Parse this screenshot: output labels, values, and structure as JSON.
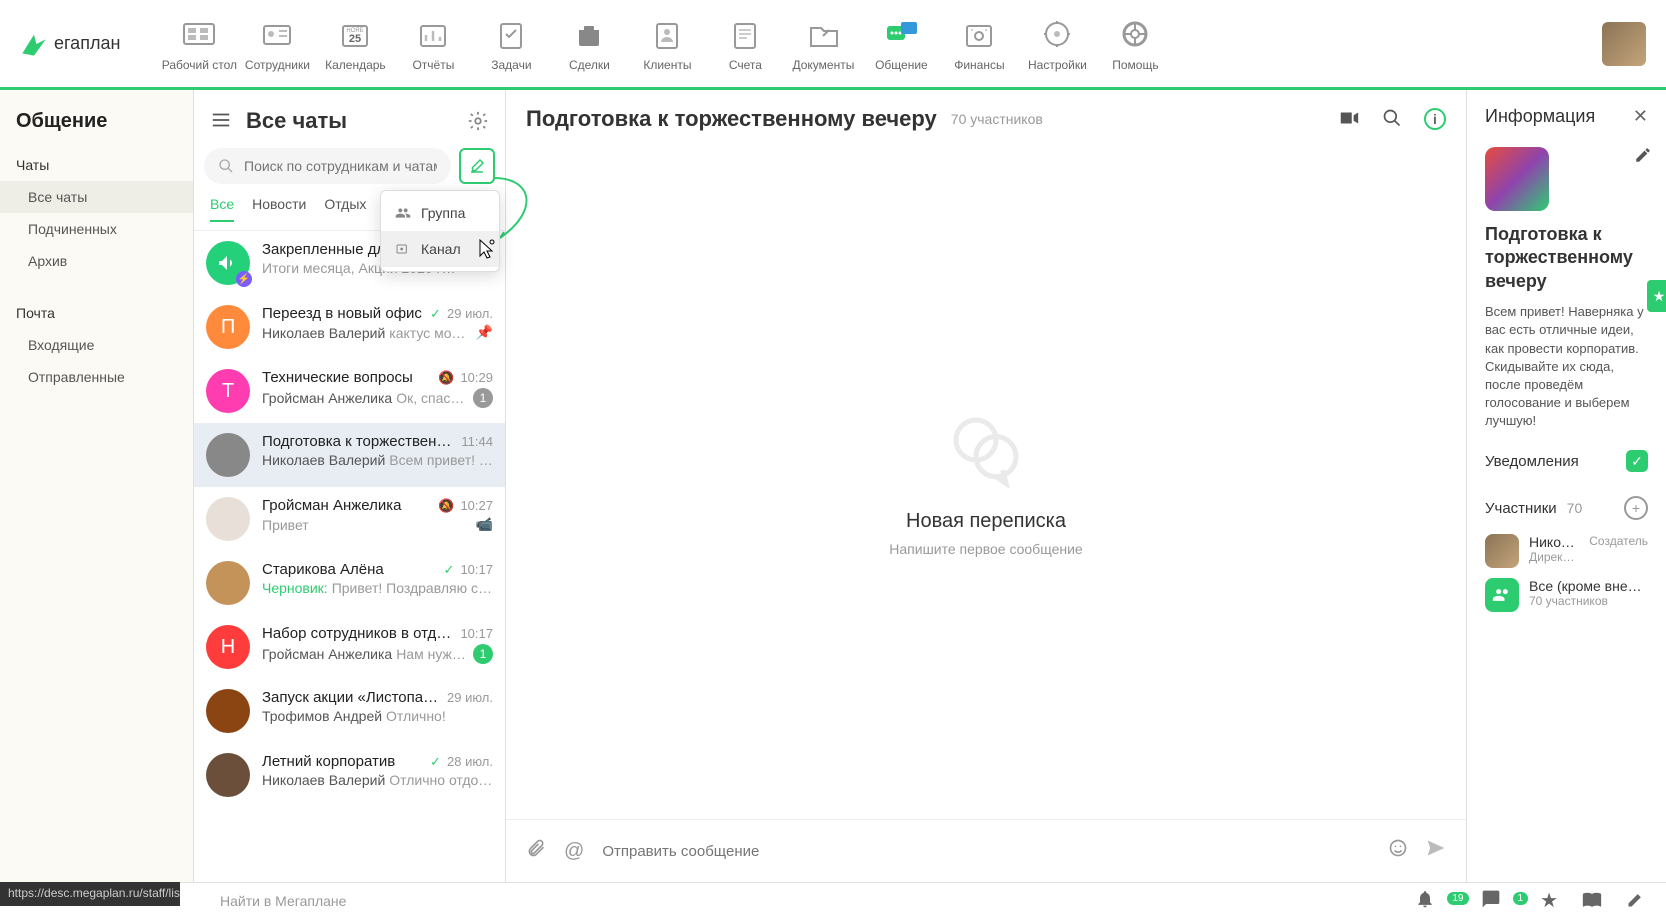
{
  "logo": "егаплан",
  "nav": [
    {
      "label": "Рабочий стол"
    },
    {
      "label": "Сотрудники"
    },
    {
      "label": "Календарь"
    },
    {
      "label": "Отчёты"
    },
    {
      "label": "Задачи"
    },
    {
      "label": "Сделки"
    },
    {
      "label": "Клиенты"
    },
    {
      "label": "Счета"
    },
    {
      "label": "Документы"
    },
    {
      "label": "Общение"
    },
    {
      "label": "Финансы"
    },
    {
      "label": "Настройки"
    },
    {
      "label": "Помощь"
    }
  ],
  "sidebar": {
    "title": "Общение",
    "chat_section": "Чаты",
    "items": [
      "Все чаты",
      "Подчиненных",
      "Архив"
    ],
    "mail_section": "Почта",
    "mail_items": [
      "Входящие",
      "Отправленные"
    ]
  },
  "chatcol": {
    "title": "Все чаты",
    "search_placeholder": "Поиск по сотрудникам и чатам",
    "tabs": [
      "Все",
      "Новости",
      "Отдых"
    ]
  },
  "dropdown": {
    "group": "Группа",
    "channel": "Канал"
  },
  "chats": [
    {
      "name": "Закрепленные для в…",
      "preview": "Итоги месяца, Акции 2020 г…",
      "avbg": "#25d07a",
      "megaphone": true
    },
    {
      "name": "Переезд в новый офис",
      "time": "29 июл.",
      "sender": "Николаев Валерий",
      "preview": "кактус можно …",
      "pin": true,
      "check": true,
      "avbg": "#ff8a3c",
      "letter": "П"
    },
    {
      "name": "Технические вопросы",
      "time": "10:29",
      "sender": "Гройсман Анжелика",
      "preview": "Ок, спасибо",
      "mute": true,
      "badge": "1",
      "avbg": "#ff3cb0",
      "letter": "Т"
    },
    {
      "name": "Подготовка к торжественном…",
      "time": "11:44",
      "sender": "Николаев Валерий",
      "preview": "Всем привет! Нав…",
      "selected": true,
      "avimg": true
    },
    {
      "name": "Гройсман Анжелика",
      "time": "10:27",
      "preview": "Привет",
      "mute": true,
      "cam": true,
      "avimg": true,
      "avbg": "#e8e0d8"
    },
    {
      "name": "Старикова Алёна",
      "time": "10:17",
      "draft": "Черновик:",
      "preview": "Привет! Поздравляю с днё…",
      "check": true,
      "avimg": true,
      "avbg": "#c4935a"
    },
    {
      "name": "Набор сотрудников в отдел пр…",
      "time": "10:17",
      "sender": "Гройсман Анжелика",
      "preview": "Нам нужно …",
      "badge": "1",
      "badgeGreen": true,
      "avbg": "#ff3c3c",
      "letter": "Н"
    },
    {
      "name": "Запуск акции «Листопад 20…",
      "time": "29 июл.",
      "sender": "Трофимов Андрей",
      "preview": "Отлично!",
      "avimg": true,
      "avbg": "#8b4513"
    },
    {
      "name": "Летний корпоратив",
      "time": "28 июл.",
      "sender": "Николаев Валерий",
      "preview": "Отлично отдохнули!",
      "check": true,
      "avimg": true,
      "avbg": "#6b4f3a"
    }
  ],
  "conv": {
    "title": "Подготовка к торжественному вечеру",
    "sub": "70 участников",
    "empty_title": "Новая переписка",
    "empty_sub": "Напишите первое сообщение",
    "composer_placeholder": "Отправить сообщение"
  },
  "info": {
    "title": "Информация",
    "chat_title": "Подготовка к торжественному вечеру",
    "desc": "Всем привет! Наверняка у вас есть отличные идеи, как провести корпоратив. Скидывайте их сюда, после проведём голосование и выберем лучшую!",
    "notif": "Уведомления",
    "participants": "Участники",
    "part_count": "70",
    "member1_name": "Никол…",
    "member1_sub": "Директ…",
    "member1_role": "Создатель",
    "member2_name": "Все (кроме вне…",
    "member2_sub": "70 участников"
  },
  "footer_search": "Найти в Мегаплане",
  "bell_count": "19",
  "chat_count": "1",
  "status_url": "https://desc.megaplan.ru/staff/list/"
}
